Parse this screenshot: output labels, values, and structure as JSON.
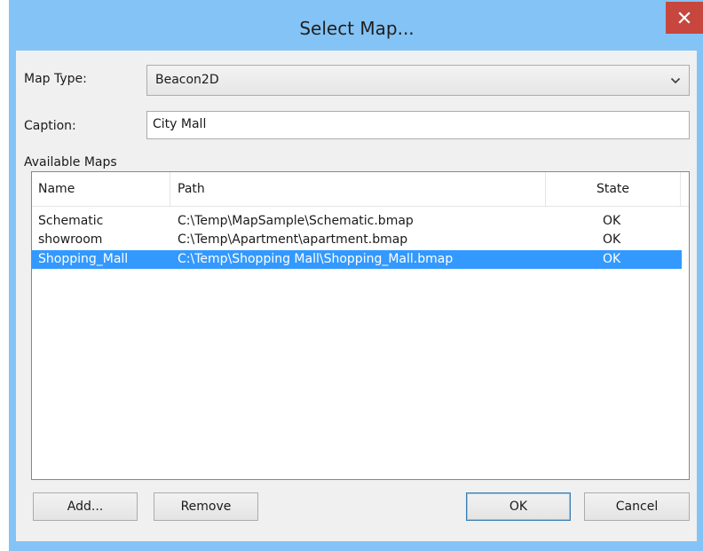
{
  "window": {
    "title": "Select Map...",
    "close_glyph": "×"
  },
  "form": {
    "map_type_label": "Map Type:",
    "map_type_value": "Beacon2D",
    "caption_label": "Caption:",
    "caption_value": "City Mall",
    "available_maps_label": "Available Maps"
  },
  "table": {
    "columns": [
      "Name",
      "Path",
      "State"
    ],
    "rows": [
      {
        "name": "Schematic",
        "path": "C:\\Temp\\MapSample\\Schematic.bmap",
        "state": "OK",
        "selected": false
      },
      {
        "name": "showroom",
        "path": "C:\\Temp\\Apartment\\apartment.bmap",
        "state": "OK",
        "selected": false
      },
      {
        "name": "Shopping_Mall",
        "path": "C:\\Temp\\Shopping Mall\\Shopping_Mall.bmap",
        "state": "OK",
        "selected": true
      }
    ]
  },
  "buttons": {
    "add": "Add...",
    "remove": "Remove",
    "ok": "OK",
    "cancel": "Cancel"
  },
  "icons": {
    "close": "close-icon",
    "dropdown": "chevron-down-icon"
  },
  "colors": {
    "title_bar": "#84c3f5",
    "close_button": "#c7463e",
    "selection": "#3399ff"
  }
}
